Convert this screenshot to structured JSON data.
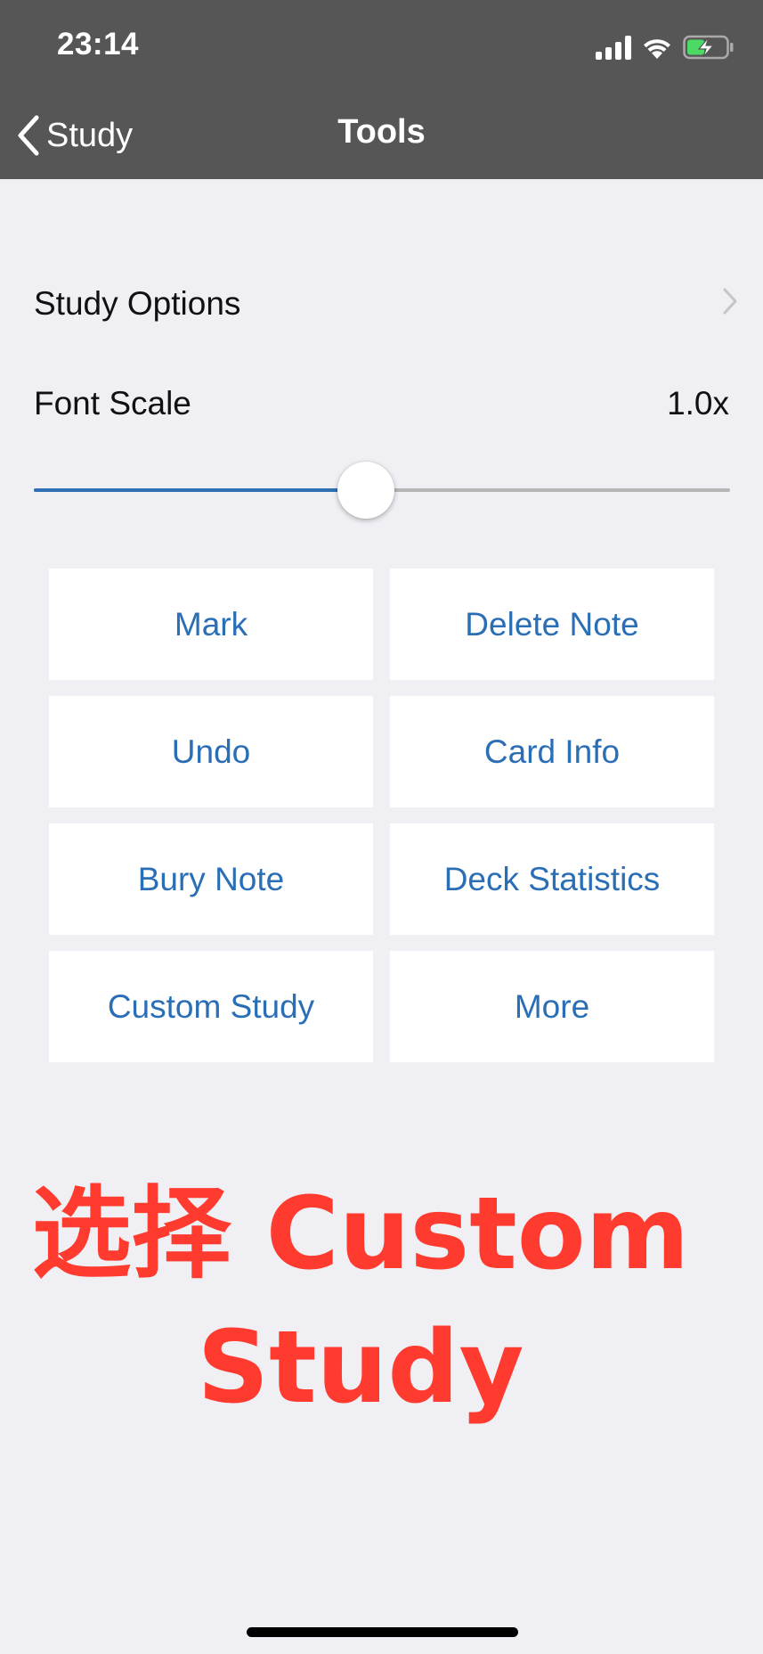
{
  "status_bar": {
    "time": "23:14",
    "icons": [
      "cellular-signal-icon",
      "wifi-icon",
      "battery-charging-icon"
    ]
  },
  "nav": {
    "back_label": "Study",
    "title": "Tools"
  },
  "study_options": {
    "label": "Study Options"
  },
  "font_scale": {
    "label": "Font Scale",
    "value": "1.0x",
    "slider_fraction": 0.477
  },
  "tools": [
    {
      "label": "Mark"
    },
    {
      "label": "Delete Note"
    },
    {
      "label": "Undo"
    },
    {
      "label": "Card Info"
    },
    {
      "label": "Bury Note"
    },
    {
      "label": "Deck Statistics"
    },
    {
      "label": "Custom Study"
    },
    {
      "label": "More"
    }
  ],
  "annotation": {
    "line1": "选择 Custom",
    "line2": "Study"
  },
  "colors": {
    "nav_background": "#565656",
    "page_background": "#efeff4",
    "accent_blue": "#2a6fb5",
    "slider_fill": "#2f6fb3",
    "annotation_red": "#ff3b2f"
  }
}
